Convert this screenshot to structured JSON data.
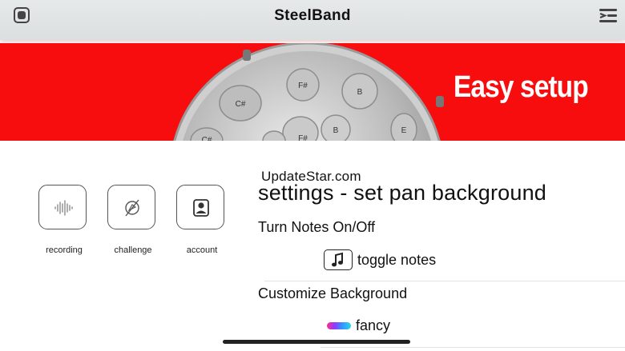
{
  "header": {
    "title": "SteelBand",
    "record_icon": "record-stop-icon",
    "menu_icon": "menu-lines-icon"
  },
  "banner": {
    "text": "Easy setup",
    "background_color": "#f70d0d",
    "note_labels": [
      "F#",
      "B",
      "C#",
      "B",
      "E",
      "C#",
      "F#"
    ]
  },
  "tools": [
    {
      "label": "recording",
      "icon": "waveform-icon"
    },
    {
      "label": "challenge",
      "icon": "compass-icon"
    },
    {
      "label": "account",
      "icon": "person-icon"
    }
  ],
  "watermark": "UpdateStar.com",
  "settings": {
    "title": "settings - set pan background",
    "notes_section": "Turn Notes On/Off",
    "toggle_label": "toggle notes",
    "toggle_icon": "music-note-icon",
    "background_section": "Customize Background",
    "background_option": "fancy",
    "background_swatch_colors": [
      "#ff2d8b",
      "#8a3cff",
      "#2f9bff",
      "#27d7e6"
    ]
  }
}
